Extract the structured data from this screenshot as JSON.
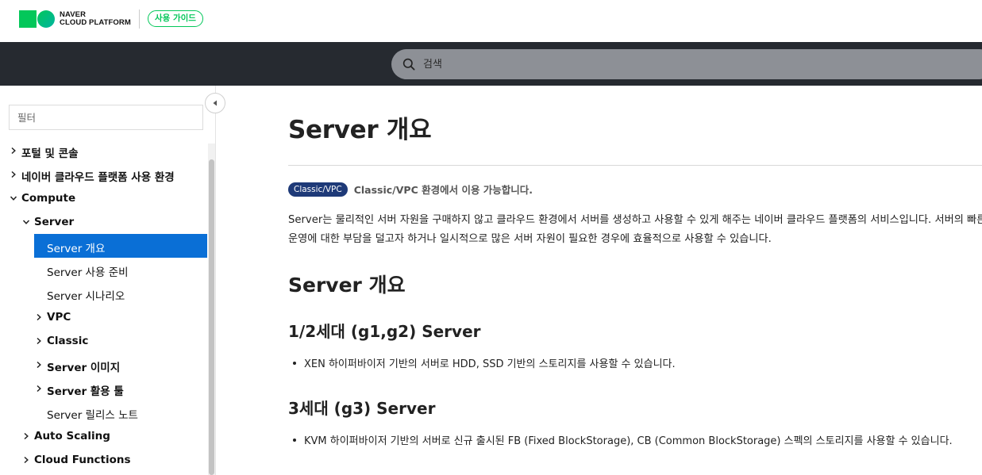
{
  "header": {
    "logo_line1": "NAVER",
    "logo_line2": "CLOUD PLATFORM",
    "guide_label": "사용 가이드",
    "search_placeholder": "검색"
  },
  "sidebar": {
    "filter_placeholder": "필터",
    "items": [
      {
        "label": "포털 및 콘솔",
        "level": 0,
        "chevron": "right",
        "bold": true
      },
      {
        "label": "네이버 클라우드 플랫폼 사용 환경",
        "level": 0,
        "chevron": "right",
        "bold": true
      },
      {
        "label": "Compute",
        "level": 0,
        "chevron": "down",
        "bold": true
      },
      {
        "label": "Server",
        "level": 1,
        "chevron": "down",
        "bold": true
      },
      {
        "label": "Server 개요",
        "level": 2,
        "chevron": "none",
        "bold": false,
        "active": true
      },
      {
        "label": "Server 사용 준비",
        "level": 2,
        "chevron": "none",
        "bold": false
      },
      {
        "label": "Server 시나리오",
        "level": 2,
        "chevron": "none",
        "bold": false
      },
      {
        "label": "VPC",
        "level": 2,
        "chevron": "right",
        "bold": true
      },
      {
        "label": "Classic",
        "level": 2,
        "chevron": "right",
        "bold": true
      },
      {
        "label": "Server 이미지",
        "level": 2,
        "chevron": "right",
        "bold": true
      },
      {
        "label": "Server 활용 툴",
        "level": 2,
        "chevron": "right",
        "bold": true
      },
      {
        "label": "Server 릴리스 노트",
        "level": 2,
        "chevron": "none",
        "bold": false
      },
      {
        "label": "Auto Scaling",
        "level": 1,
        "chevron": "right",
        "bold": true
      },
      {
        "label": "Cloud Functions",
        "level": 1,
        "chevron": "right",
        "bold": true
      }
    ]
  },
  "main": {
    "title": "Server 개요",
    "env_badge": "Classic/VPC",
    "env_text": "Classic/VPC 환경에서 이용 가능합니다.",
    "intro_line1": "Server는 물리적인 서버 자원을 구매하지 않고 클라우드 환경에서 서버를 생성하고 사용할 수 있게 해주는 네이버 클라우드 플랫폼의 서비스입니다. 서버의 빠른 생",
    "intro_line2": "운영에 대한 부담을 덜고자 하거나 일시적으로 많은 서버 자원이 필요한 경우에 효율적으로 사용할 수 있습니다.",
    "section_title": "Server 개요",
    "gen12_title": "1/2세대 (g1,g2) Server",
    "gen12_bullet": "XEN 하이퍼바이저 기반의 서버로 HDD, SSD 기반의 스토리지를 사용할 수 있습니다.",
    "gen3_title": "3세대 (g3) Server",
    "gen3_bullet": "KVM 하이퍼바이저 기반의 서버로 신규 출시된 FB (Fixed BlockStorage), CB (Common BlockStorage) 스펙의 스토리지를 사용할 수 있습니다."
  }
}
